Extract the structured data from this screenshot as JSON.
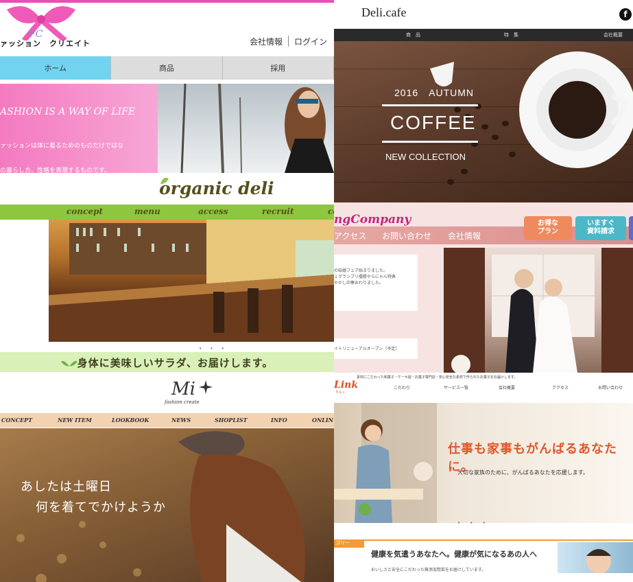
{
  "fashion_create": {
    "brand": "ァッション　クリエイト",
    "header_links": [
      "会社情報",
      "ログイン"
    ],
    "nav": [
      "ホーム",
      "商品",
      "採用"
    ],
    "slogan": "ASHION IS A WAY OF LIFE",
    "desc_line1": "ァッションは体に着るためのものだけではな",
    "desc_line2": "の暮らし方、性格を表現するものです。",
    "colors": {
      "accent": "#e84fb4",
      "nav_active": "#72d3f0"
    }
  },
  "deli_cafe": {
    "logo": "Deli.cafe",
    "fb_icon": "f",
    "nav": [
      "商　品",
      "特　集",
      "会社概要"
    ],
    "year_line": "2016　AUTUMN",
    "headline": "COFFEE",
    "collection": "NEW COLLECTION"
  },
  "organic_deli": {
    "logo": "organic deli",
    "nav": [
      "concept",
      "menu",
      "access",
      "recruit",
      "co"
    ],
    "dots": "• • •",
    "tagline": "身体に美味しいサラダ、お届けします。"
  },
  "wedding": {
    "logo": "ngCompany",
    "nav": [
      "アクセス",
      "お問い合わせ",
      "会社情報"
    ],
    "badges": [
      "お得な\nプラン",
      "いますぐ\n資料請求"
    ],
    "news_line1": "の結婚フェア始まりました。",
    "news_line2": "１グランプリ優勝やらにゃん特典",
    "news_line3": "やかし中寒おわりました。",
    "news_line4": "イトリニューアルオープン（予定）"
  },
  "mi_fashion": {
    "logo": "Mi",
    "sub": "fashion create",
    "nav": [
      "CONCEPT",
      "NEW ITEM",
      "LOOKBOOK",
      "NEWS",
      "SHOPLIST",
      "INFO",
      "ONLIN"
    ],
    "line1": "あしたは土曜日",
    "line2": "何を着てでかけようか"
  },
  "link": {
    "logo": "Link",
    "logo_sub": "りんく",
    "tagline": "素材にこだわった和菓子・ケーキ屋・お菓子専門店・安心安全な素材で作られたお菓子をお届けします。",
    "nav": [
      "こだわり",
      "サービス一覧",
      "会社概要",
      "アクセス",
      "お問い合わせ"
    ],
    "headline": "仕事も家事もがんばるあなたに。",
    "subline": "大切な家族のために、がんばるあなたを応援します。",
    "dots": "• • •",
    "category": "ゴリー",
    "section_title": "健康を気遣うあなたへ。健康が気になるあの人へ",
    "section_sub": "おいしさと安全にこだわった無添加惣菜をお届けしています。"
  }
}
